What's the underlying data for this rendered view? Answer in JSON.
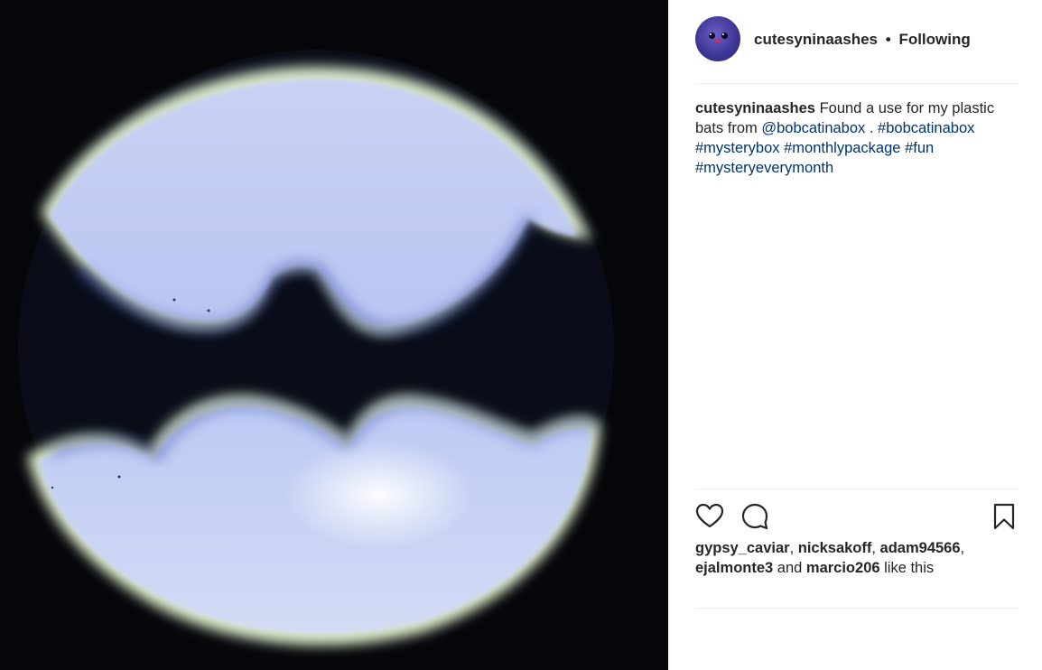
{
  "post": {
    "image_alt": "",
    "username": "cutesyninaashes",
    "separator": "•",
    "follow_status": "Following"
  },
  "caption": {
    "username": "cutesyninaashes",
    "text_before": " Found a use for my plastic bats from ",
    "mention": "@bobcatinabox",
    "text_after": " . ",
    "hashtags": [
      "#bobcatinabox",
      "#mysterybox",
      "#monthlypackage",
      "#fun",
      "#mysteryeverymonth"
    ]
  },
  "likes": {
    "users": [
      "gypsy_caviar",
      "nicksakoff",
      "adam94566",
      "ejalmonte3",
      "marcio206"
    ],
    "comma": ", ",
    "and_word": " and ",
    "suffix": " like this"
  },
  "icons": {
    "like": "heart-icon",
    "comment": "comment-icon",
    "save": "bookmark-icon"
  }
}
